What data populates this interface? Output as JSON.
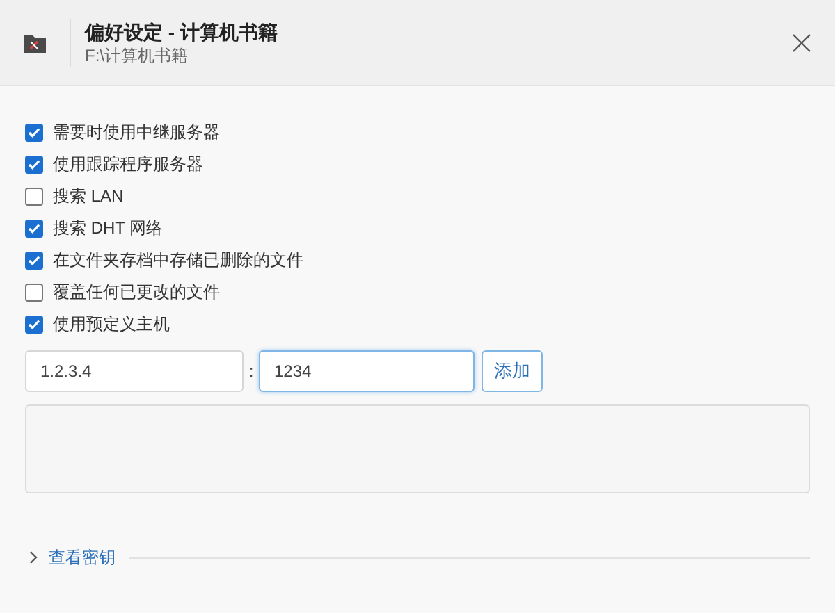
{
  "window": {
    "title": "偏好设定 - 计算机书籍",
    "subtitle": "F:\\计算机书籍"
  },
  "options": [
    {
      "label": "需要时使用中继服务器",
      "checked": true
    },
    {
      "label": "使用跟踪程序服务器",
      "checked": true
    },
    {
      "label": "搜索 LAN",
      "checked": false
    },
    {
      "label": "搜索 DHT 网络",
      "checked": true
    },
    {
      "label": "在文件夹存档中存储已删除的文件",
      "checked": true
    },
    {
      "label": "覆盖任何已更改的文件",
      "checked": false
    },
    {
      "label": "使用预定义主机",
      "checked": true
    }
  ],
  "host": {
    "address": "1.2.3.4",
    "separator": ":",
    "port": "1234",
    "add_button": "添加"
  },
  "expander": {
    "label": "查看密钥",
    "expanded": false
  }
}
